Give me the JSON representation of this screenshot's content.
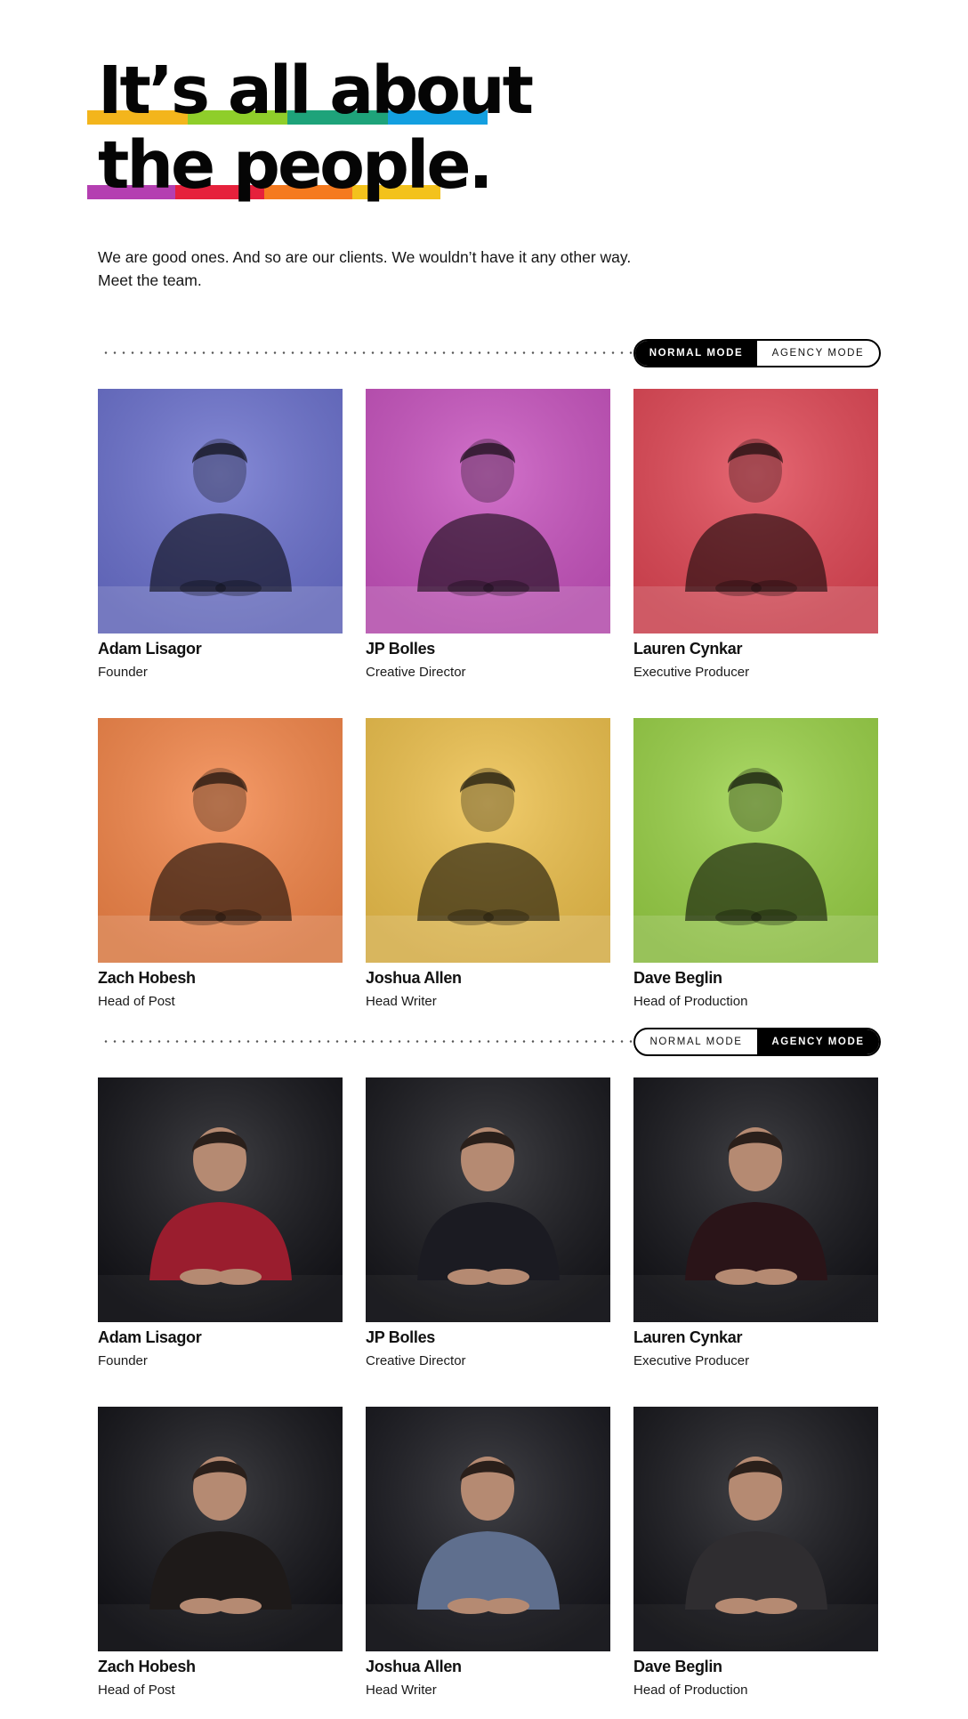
{
  "headline": {
    "line1": "It’s all about",
    "line2": "the people.",
    "bar1_colors": [
      "#f3b51c",
      "#8fce2a",
      "#1ea37a",
      "#139fe0"
    ],
    "bar2_colors": [
      "#b43fb1",
      "#e6213c",
      "#f57a1f",
      "#f3c21c"
    ]
  },
  "intro": {
    "line1": "We are good ones. And so are our clients. We wouldn’t have it any other way.",
    "line2": "Meet the team."
  },
  "toggle_normal": {
    "normal_label": "NORMAL MODE",
    "agency_label": "AGENCY MODE",
    "active": "normal"
  },
  "toggle_agency": {
    "normal_label": "NORMAL MODE",
    "agency_label": "AGENCY MODE",
    "active": "agency"
  },
  "normal_team": [
    {
      "name": "Adam Lisagor",
      "role": "Founder",
      "bg": "#6c72cf",
      "icon": "person-photo"
    },
    {
      "name": "JP Bolles",
      "role": "Creative Director",
      "bg": "#c954c0",
      "icon": "person-photo"
    },
    {
      "name": "Lauren Cynkar",
      "role": "Executive Producer",
      "bg": "#e24856",
      "icon": "person-photo"
    },
    {
      "name": "Zach Hobesh",
      "role": "Head of Post",
      "bg": "#f5874a",
      "icon": "person-photo"
    },
    {
      "name": "Joshua Allen",
      "role": "Head Writer",
      "bg": "#efc24d",
      "icon": "person-photo"
    },
    {
      "name": "Dave Beglin",
      "role": "Head of Production",
      "bg": "#9bd348",
      "icon": "person-photo"
    }
  ],
  "agency_team": [
    {
      "name": "Adam Lisagor",
      "role": "Founder",
      "bg": "#141419",
      "accent": "#9a1d2e",
      "icon": "person-photo"
    },
    {
      "name": "JP Bolles",
      "role": "Creative Director",
      "bg": "#17171c",
      "accent": "#1b1b22",
      "icon": "person-photo"
    },
    {
      "name": "Lauren Cynkar",
      "role": "Executive Producer",
      "bg": "#15151a",
      "accent": "#2a1418",
      "icon": "person-photo"
    },
    {
      "name": "Zach Hobesh",
      "role": "Head of Post",
      "bg": "#131318",
      "accent": "#1e1a19",
      "icon": "person-photo"
    },
    {
      "name": "Joshua Allen",
      "role": "Head Writer",
      "bg": "#17171d",
      "accent": "#5f6f8e",
      "icon": "person-photo"
    },
    {
      "name": "Dave Beglin",
      "role": "Head of Production",
      "bg": "#16161b",
      "accent": "#2f2d30",
      "icon": "person-photo"
    }
  ]
}
